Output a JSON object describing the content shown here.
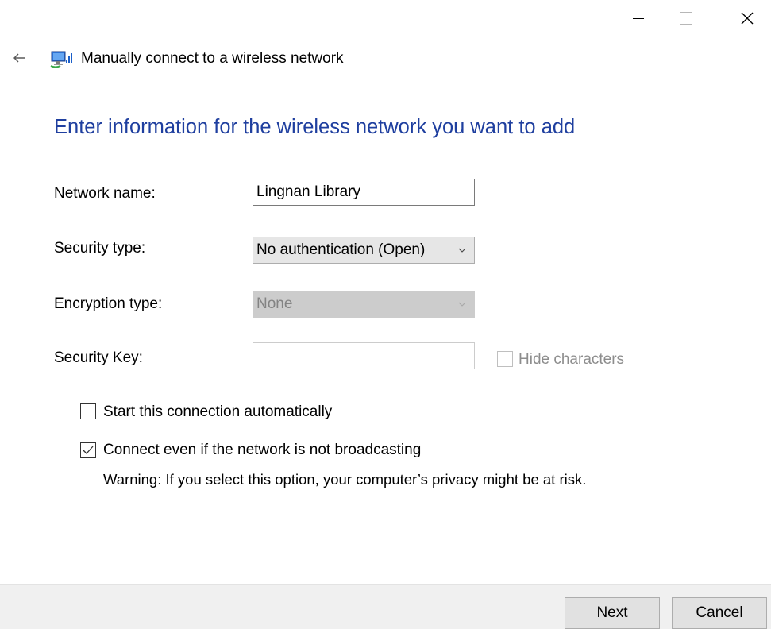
{
  "window": {
    "title": "Manually connect to a wireless network",
    "icons": {
      "back": "back-arrow-icon",
      "network": "wireless-network-icon",
      "minimize": "minimize-icon",
      "maximize": "maximize-icon",
      "close": "close-icon"
    }
  },
  "heading": "Enter information for the wireless network you want to add",
  "form": {
    "network_name": {
      "label": "Network name:",
      "value": "Lingnan Library"
    },
    "security_type": {
      "label": "Security type:",
      "selected": "No authentication (Open)"
    },
    "encryption_type": {
      "label": "Encryption type:",
      "selected": "None"
    },
    "security_key": {
      "label": "Security Key:",
      "value": "",
      "hide_characters_label": "Hide characters"
    }
  },
  "options": {
    "start_automatically": {
      "label": "Start this connection automatically",
      "checked": false
    },
    "connect_not_broadcasting": {
      "label": "Connect even if the network is not broadcasting",
      "checked": true
    },
    "warning": "Warning: If you select this option, your computer’s privacy might be at risk."
  },
  "buttons": {
    "next": "Next",
    "cancel": "Cancel"
  },
  "colors": {
    "heading": "#1f3f9f",
    "footer_bg": "#f0f0f0",
    "button_bg": "#e1e1e1"
  }
}
